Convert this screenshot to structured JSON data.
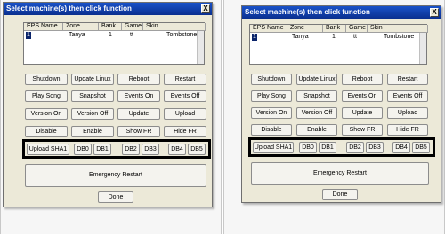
{
  "dialog": {
    "title": "Select machine(s) then click function",
    "close_glyph": "X"
  },
  "machine_list": {
    "columns": [
      "EPS Name",
      "Zone",
      "Bank",
      "Game",
      "Skin"
    ],
    "rows": [
      {
        "eps": "1",
        "zone": "Tanya",
        "bank": "1",
        "game": "tt",
        "skin": "Tombstone"
      }
    ]
  },
  "buttons": {
    "shutdown": "Shutdown",
    "update_linux": "Update Linux",
    "reboot": "Reboot",
    "restart": "Restart",
    "play_song": "Play Song",
    "snapshot": "Snapshot",
    "events_on": "Events On",
    "events_off": "Events Off",
    "version_on": "Version On",
    "version_off": "Version Off",
    "update": "Update",
    "upload": "Upload",
    "disable": "Disable",
    "enable": "Enable",
    "show_fr": "Show FR",
    "hide_fr": "Hide FR",
    "upload_sha1": "Upload SHA1",
    "db0": "DB0",
    "db1": "DB1",
    "db2": "DB2",
    "db3": "DB3",
    "db4": "DB4",
    "db5": "DB5",
    "emergency_restart": "Emergency Restart",
    "done": "Done"
  },
  "colors": {
    "titlebar": "#0a2f8f",
    "dialog_bg": "#ece9d8",
    "selection": "#0a246a",
    "highlight_border": "#000000"
  }
}
